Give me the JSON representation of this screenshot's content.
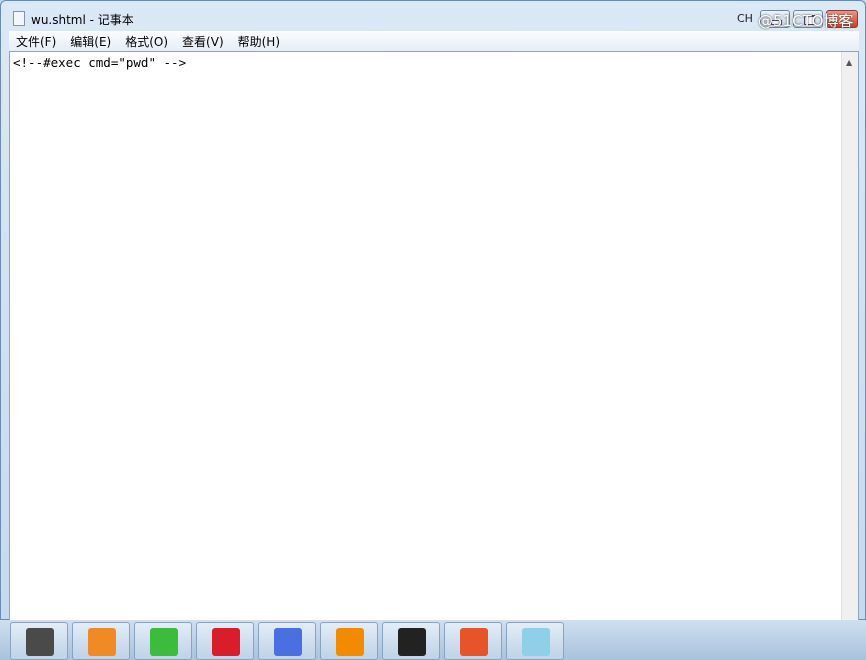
{
  "window": {
    "title": "wu.shtml - 记事本"
  },
  "menu": [
    "文件(F)",
    "编辑(E)",
    "格式(O)",
    "查看(V)",
    "帮助(H)"
  ],
  "editor": {
    "content": "<!--#exec cmd=\"pwd\" -->"
  },
  "taskbar": {
    "apps": [
      {
        "name": "sublime-text",
        "color": "#4a4a4a"
      },
      {
        "name": "media-player",
        "color": "#f08a24"
      },
      {
        "name": "wechat",
        "color": "#3dbb3d"
      },
      {
        "name": "netease-music",
        "color": "#d81e2b"
      },
      {
        "name": "feishu",
        "color": "#4a6fe0"
      },
      {
        "name": "vmware",
        "color": "#f38b00"
      },
      {
        "name": "terminal",
        "color": "#222222"
      },
      {
        "name": "burp-suite",
        "color": "#e8542a"
      },
      {
        "name": "notepad",
        "color": "#8fd0e8"
      }
    ],
    "tray_lang": "CH",
    "watermark": "@51CTO博客"
  }
}
